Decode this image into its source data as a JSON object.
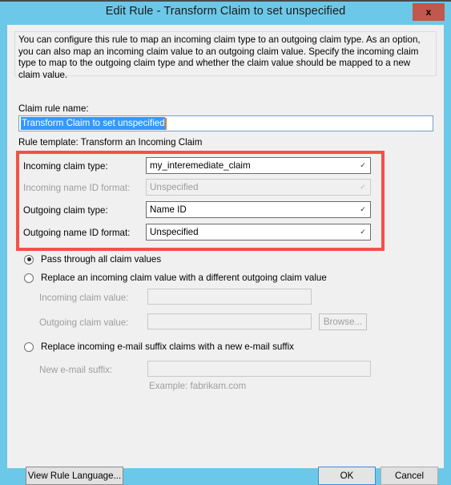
{
  "window": {
    "title": "Edit Rule - Transform Claim to set unspecified",
    "close_label": "x",
    "close_icon": "close-icon"
  },
  "description": "You can configure this rule to map an incoming claim type to an outgoing claim type. As an option, you can also map an incoming claim value to an outgoing claim value. Specify the incoming claim type to map to the outgoing claim type and whether the claim value should be mapped to a new claim value.",
  "claim_rule_name": {
    "label": "Claim rule name:",
    "value": "Transform Claim to set unspecified",
    "selected": true
  },
  "rule_template": "Rule template: Transform an Incoming Claim",
  "mapping": {
    "incoming_claim_type": {
      "label": "Incoming claim type:",
      "value": "my_interemediate_claim",
      "enabled": true
    },
    "incoming_name_id_format": {
      "label": "Incoming name ID format:",
      "value": "Unspecified",
      "enabled": false
    },
    "outgoing_claim_type": {
      "label": "Outgoing claim type:",
      "value": "Name ID",
      "enabled": true
    },
    "outgoing_name_id_format": {
      "label": "Outgoing name ID format:",
      "value": "Unspecified",
      "enabled": true
    }
  },
  "options": {
    "pass_through": {
      "label": "Pass through all claim values",
      "checked": true
    },
    "replace_value": {
      "label": "Replace an incoming claim value with a different outgoing claim value",
      "checked": false,
      "incoming_claim_value_label": "Incoming claim value:",
      "incoming_claim_value": "",
      "outgoing_claim_value_label": "Outgoing claim value:",
      "outgoing_claim_value": "",
      "browse_label": "Browse..."
    },
    "replace_suffix": {
      "label": "Replace incoming e-mail suffix claims with a new e-mail suffix",
      "checked": false,
      "new_email_suffix_label": "New e-mail suffix:",
      "new_email_suffix": "",
      "example": "Example: fabrikam.com"
    }
  },
  "buttons": {
    "view_rule_language": "View Rule Language...",
    "ok": "OK",
    "cancel": "Cancel"
  },
  "colors": {
    "titlebar": "#6cc8e8",
    "close_button": "#c1574d",
    "annotation_red": "#f5504a",
    "selection_blue": "#3399ff",
    "focus_border": "#3c8bd0"
  }
}
